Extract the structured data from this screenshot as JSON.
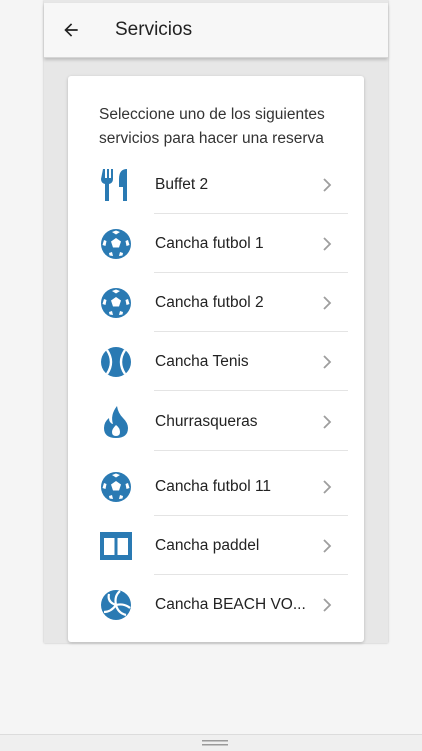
{
  "appbar": {
    "title": "Servicios",
    "back_icon": "arrow-left-icon"
  },
  "intro_text": "Seleccione uno de los siguientes servicios para hacer una reserva",
  "colors": {
    "icon_blue": "#2a7ab3",
    "chevron": "#9e9e9e"
  },
  "services": [
    {
      "label": "Buffet 2",
      "icon": "fork-knife-icon"
    },
    {
      "label": "Cancha futbol 1",
      "icon": "soccer-ball-icon"
    },
    {
      "label": "Cancha futbol 2",
      "icon": "soccer-ball-icon"
    },
    {
      "label": "Cancha Tenis",
      "icon": "tennis-ball-icon"
    },
    {
      "label": "Churrasqueras",
      "icon": "flame-icon"
    },
    {
      "label": "Cancha futbol 11",
      "icon": "soccer-ball-icon"
    },
    {
      "label": "Cancha paddel",
      "icon": "paddel-court-icon"
    },
    {
      "label": "Cancha BEACH VO...",
      "icon": "volleyball-icon"
    }
  ]
}
